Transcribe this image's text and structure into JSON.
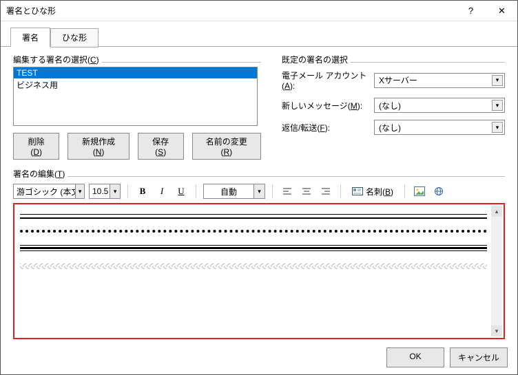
{
  "window": {
    "title": "署名とひな形",
    "help": "?",
    "close": "✕"
  },
  "tabs": {
    "signature": "署名",
    "stationery": "ひな形"
  },
  "left": {
    "legend_pre": "編集する署名の選択(",
    "legend_key": "C",
    "legend_post": ")",
    "items": [
      "TEST",
      "ビジネス用"
    ],
    "buttons": {
      "delete_pre": "削除(",
      "delete_key": "D",
      "delete_post": ")",
      "new_pre": "新規作成(",
      "new_key": "N",
      "new_post": ")",
      "save_pre": "保存(",
      "save_key": "S",
      "save_post": ")",
      "rename_pre": "名前の変更(",
      "rename_key": "R",
      "rename_post": ")"
    }
  },
  "right": {
    "legend": "既定の署名の選択",
    "rows": {
      "account_pre": "電子メール アカウント(",
      "account_key": "A",
      "account_post": "):",
      "account_value": "Xサーバー",
      "newmsg_pre": "新しいメッセージ(",
      "newmsg_key": "M",
      "newmsg_post": "):",
      "newmsg_value": "(なし)",
      "reply_pre": "返信/転送(",
      "reply_key": "F",
      "reply_post": "):",
      "reply_value": "(なし)"
    }
  },
  "edit": {
    "legend_pre": "署名の編集(",
    "legend_key": "T",
    "legend_post": ")",
    "font": "游ゴシック (本文の",
    "size": "10.5",
    "bold": "B",
    "italic": "I",
    "underline": "U",
    "color": "自動",
    "bizcard_pre": "名刺(",
    "bizcard_key": "B",
    "bizcard_post": ")"
  },
  "footer": {
    "ok": "OK",
    "cancel": "キャンセル"
  }
}
